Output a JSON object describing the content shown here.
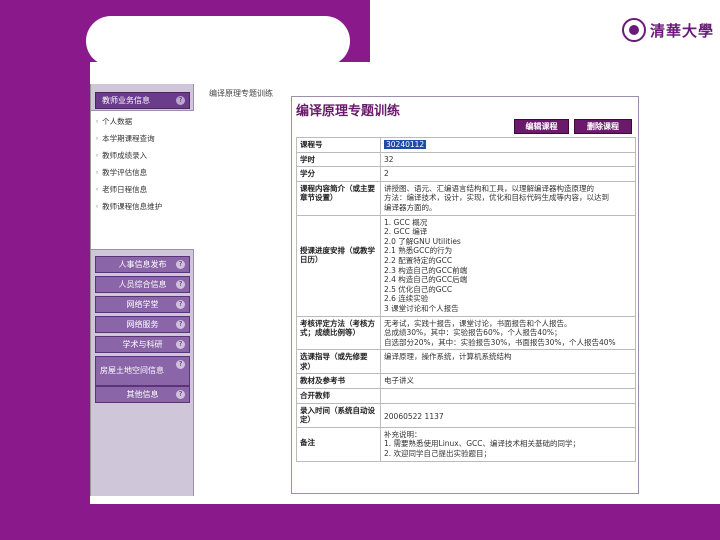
{
  "logo": {
    "text": "清華大學"
  },
  "sidebar": {
    "header_label": "教师业务信息",
    "submenu": [
      "个人数据",
      "本学期课程查询",
      "教师成绩录入",
      "教学评估信息",
      "老师日程信息",
      "教师课程信息维护"
    ],
    "sections": [
      "人事信息发布",
      "人员综合信息",
      "网络学堂",
      "网络服务",
      "学术与科研",
      "房屋土地空间信息",
      "其他信息"
    ],
    "section_icon": "?"
  },
  "breadcrumb": "编译原理专题训练",
  "main": {
    "title": "编译原理专题训练",
    "edit_button": "编辑课程",
    "delete_button": "删除课程",
    "rows": {
      "code": {
        "label": "课程号",
        "value": "30240112"
      },
      "hours": {
        "label": "学时",
        "value": "32"
      },
      "credits": {
        "label": "学分",
        "value": "2"
      },
      "intro": {
        "label": "课程内容简介（或主要章节设置）",
        "lines": [
          "讲授图、语元、汇编语言结构和工具，以理解编译器构造原理的",
          "方法：编译技术，设计，实现，优化和目标代码生成等内容，以达到",
          "编译器方面的。"
        ]
      },
      "schedule": {
        "label": "授课进度安排（或教学日历）",
        "lines": [
          "1. GCC 概况",
          "2. GCC 编译",
          "2.0 了解GNU Utilities",
          "2.1 熟悉GCC的行为",
          "2.2 配置特定的GCC",
          "2.3 构造自己的GCC前端",
          "2.4 构造自己的GCC后端",
          "2.5 优化自己的GCC",
          "2.6 连续实验",
          "3 课堂讨论和个人报告"
        ]
      },
      "assessment": {
        "label": "考核评定方法（考核方式；成绩比例等）",
        "lines": [
          "无考试，实践十报告，课堂讨论，书面报告和个人报告。",
          "总成绩30%，其中：实验报告60%，个人报告40%；",
          "自选部分20%，其中：实验报告30%，书面报告30%，个人报告40%"
        ]
      },
      "guidance": {
        "label": "选课指导（或先修要求）",
        "value": "编译原理，操作系统，计算机系统结构"
      },
      "textbook": {
        "label": "教材及参考书",
        "value": "电子讲义"
      },
      "offered": {
        "label": "合开教师",
        "value": ""
      },
      "entry_time": {
        "label": "录入时间（系统自动设定）",
        "value": "20060522 1137"
      },
      "notes": {
        "label": "备注",
        "lines": [
          "补充说明：",
          "1. 需要熟悉使用Linux、GCC、编译技术相关基础的同学；",
          "2. 欢迎同学自己提出实验题目；"
        ]
      }
    }
  },
  "colors": {
    "slide_purple": "#8a1a8c",
    "menu_header": "#6b3b8c",
    "title_color": "#6b1a6b",
    "selection": "#1f4aa8"
  }
}
